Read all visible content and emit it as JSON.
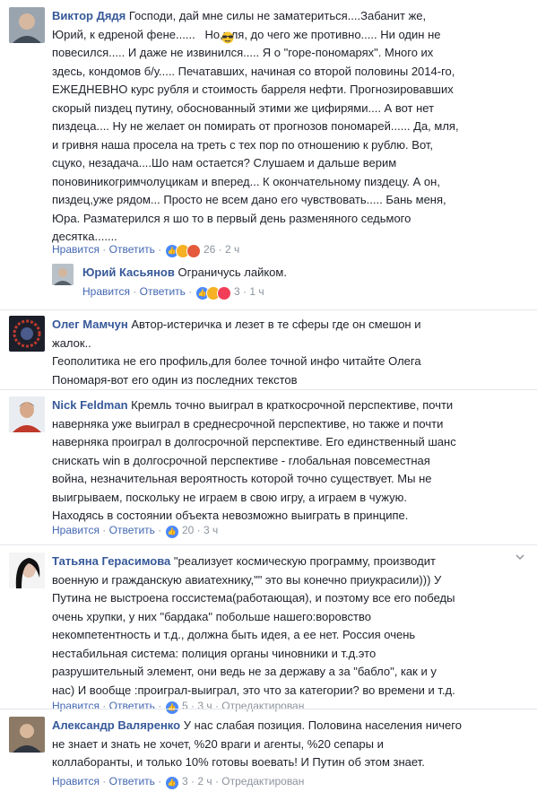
{
  "comments": [
    {
      "author": "Виктор Дядя",
      "text": "Господи, дай мне силы не заматериться....Забанит же,\nЮрий, к едреной фене......   Но,мля, до чего же противно..... Ни один не\nповесился..... И даже не извинился..... Я о \"горе-пономарях\". Много их\nздесь, кондомов б/у..... Печатавших, начиная со второй половины 2014-го,\nЕЖЕДНЕВНО курс рубля и стоимость барреля нефти. Прогнозировавших\nскорый пиздец путину, обоснованный этими же цифирями.... А вот нет\nпиздеца.... Ну не желает он помирать от прогнозов пономарей...... Да, мля,\nи гривня наша просела на треть с тех пор по отношению к рублю. Вот,\nсцуко, незадача....Шо нам остается? Слушаем и дальше верим\nпоновиникогримчолуцикам и вперед... К окончательному пиздецу. А он,\nпиздец,уже рядом... Просто не всем дано его чувствовать..... Бань меня,\nЮра. Разматерился я шо то в первый день разменяного седьмого\nдесятка.......",
      "emoji_icon": "sunglasses-emoji-icon",
      "like_label": "Нравится",
      "reply_label": "Ответить",
      "reaction_count": "26",
      "time": "2 ч"
    },
    {
      "author": "Юрий Касьянов",
      "text": "Ограничусь лайком.",
      "like_label": "Нравится",
      "reply_label": "Ответить",
      "reaction_count": "3",
      "time": "1 ч"
    },
    {
      "author": "Олег Мамчун",
      "text": "Автор-истеричка и лезет в те сферы где он смешон и\nжалок..\nГеополитика не его профиль,для более точной инфо читайте Олега\nПономаря-вот его один из последних текстов"
    },
    {
      "author": "Nick Feldman",
      "text": "Кремль точно выиграл в краткосрочной перспективе, почти\nнаверняка уже выиграл в среднесрочной перспективе, но также и почти\nнаверняка проиграл в долгосрочной перспективе. Его единственный шанс\nснискать win в долгосрочной перспективе - глобальная повсеместная\nвойна, незначительная вероятность которой точно существует. Мы не\nвыигрываем, поскольку не играем в свою игру, а играем в чужую.\nНаходясь в состоянии объекта невозможно выиграть в принципе.",
      "like_label": "Нравится",
      "reply_label": "Ответить",
      "reaction_count": "20",
      "time": "3 ч"
    },
    {
      "author": "Татьяна Герасимова",
      "text": "\"реализует космическую программу, производит\nвоенную и гражданскую авиатехнику,\"\" это вы конечно приукрасили))) У\nПутина не выстроена госсистема(работающая), и поэтому все его победы\nочень хрупки, у них \"бардака\" побольше нашего:воровство\nнекомпетентность и т.д., должна быть идея, а ее нет. Россия очень\nнестабильная система: полиция органы чиновники и т.д.это\nразрушительный элемент, они ведь не за державу а за \"бабло\", как и у\nнас) И вообще :проиграл-выиграл, это что за категории? во времени и т.д.",
      "like_label": "Нравится",
      "reply_label": "Ответить",
      "reaction_count": "5",
      "time": "3 ч",
      "extra_label": "Отредактирован",
      "menu_icon": "chevron-down-icon"
    },
    {
      "author": "Александр Валяренко",
      "text": "У нас слабая позиция. Половина населения ничего\nне знает и знать не хочет, %20 враги и агенты, %20 сепары и\nколлаборанты, и только 10% готовы воевать! И Путин об этом знает.",
      "like_label": "Нравится",
      "reply_label": "Ответить",
      "reaction_count": "3",
      "time": "2 ч",
      "extra_label": "Отредактирован"
    }
  ],
  "colors": {
    "name": "#365899",
    "link": "#4267b2",
    "meta": "#8d949e",
    "text": "#1d2129",
    "like_reaction": "#4b89ff",
    "haha_reaction": "#f7b125",
    "love_reaction": "#f33e58",
    "angry_reaction": "#e45a3a"
  }
}
